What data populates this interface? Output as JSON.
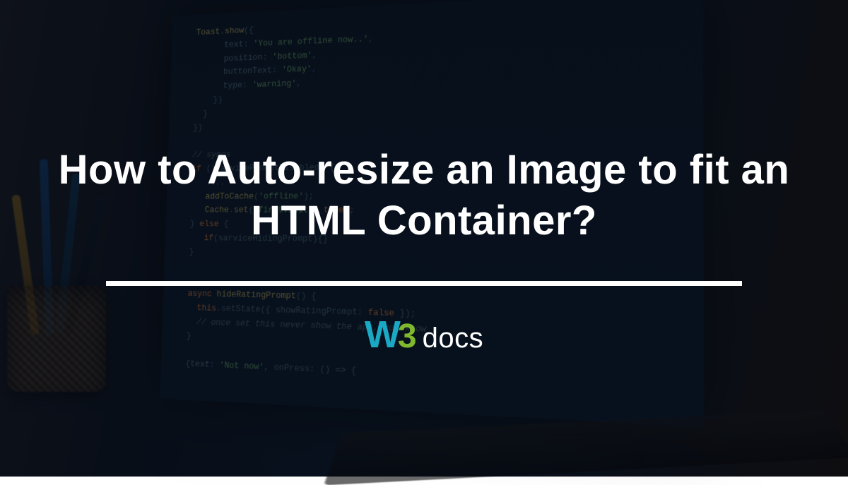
{
  "title": "How to Auto-resize an Image to fit an HTML Container?",
  "logo": {
    "part_w": "W",
    "part_3": "3",
    "part_docs": "docs"
  },
  "colors": {
    "title_text": "#ffffff",
    "divider": "#ffffff",
    "logo_w": "#1aa8c4",
    "logo_3": "#7fb82e",
    "logo_docs": "#ffffff",
    "background_overlay": "rgba(5,10,18,0.55)"
  }
}
